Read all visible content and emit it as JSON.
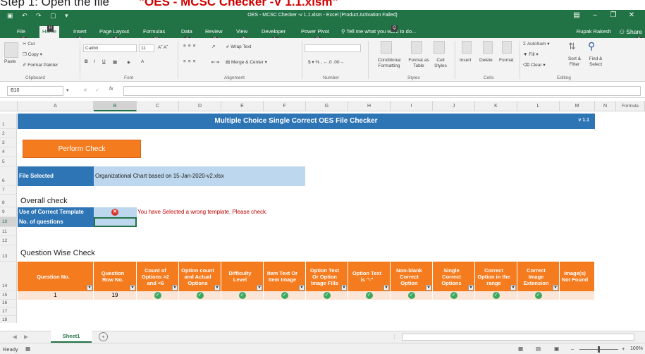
{
  "caption": {
    "prefix": "Step 1: Open the file",
    "file": "\"OES - MCSC Checker -V 1.1.xlsm\""
  },
  "window": {
    "title": "OES - MCSC Checker -v 1.1.xlsm - Excel (Product Activation Failed)"
  },
  "menu": {
    "tabs": [
      "File",
      "Home",
      "Insert",
      "Page Layout",
      "Formulas",
      "Data",
      "Review",
      "View",
      "Developer",
      "Power Pivot"
    ],
    "tell_me": "Tell me what you want to do...",
    "user": "Rupak Rakesh",
    "share": "Share",
    "keytips": [
      "F",
      "H",
      "N",
      "P",
      "M",
      "A",
      "R",
      "W",
      "L",
      "B",
      "Q",
      "Y"
    ]
  },
  "ribbon": {
    "clipboard": {
      "paste": "Paste",
      "cut": "Cut",
      "copy": "Copy",
      "format_painter": "Format Painter",
      "label": "Clipboard"
    },
    "font": {
      "name": "Calibri",
      "size": "11",
      "label": "Font"
    },
    "alignment": {
      "wrap": "Wrap Text",
      "merge": "Merge & Center",
      "label": "Alignment"
    },
    "number": {
      "format": "",
      "label": "Number"
    },
    "styles": {
      "conditional": "Conditional Formatting",
      "format_as_table": "Format as Table",
      "cell_styles": "Cell Styles",
      "label": "Styles"
    },
    "cells": {
      "insert": "Insert",
      "delete": "Delete",
      "format": "Format",
      "label": "Cells"
    },
    "editing": {
      "autosum": "AutoSum",
      "fill": "Fill",
      "clear": "Clear",
      "sort": "Sort & Filter",
      "find": "Find & Select",
      "label": "Editing"
    }
  },
  "formula_bar": {
    "name_box": "B10",
    "fx": "fx",
    "content": ""
  },
  "columns": [
    "A",
    "B",
    "C",
    "D",
    "E",
    "F",
    "G",
    "H",
    "I",
    "J",
    "K",
    "L",
    "M",
    "N"
  ],
  "rows": [
    "1",
    "2",
    "3",
    "4",
    "5",
    "6",
    "7",
    "8",
    "9",
    "10",
    "11",
    "12",
    "13",
    "14",
    "15",
    "16",
    "17",
    "18"
  ],
  "sheet": {
    "banner_title": "Multiple Choice Single Correct OES File Checker",
    "version": "v 1.1",
    "perform_button": "Perform Check",
    "file_selected_label": "File Selected",
    "file_selected_value": "Organizational Chart based on 15-Jan-2020-v2.xlsx",
    "overall_check": "Overall check",
    "template_label": "Use of Correct Template",
    "template_message": "You have Selected a wrong template. Please check.",
    "questions_label": "No. of questions",
    "question_wise": "Question Wise Check",
    "formula_label": "Formula",
    "table_headers": [
      "Question No.",
      "Question Row No.",
      "Count of Options >2 and <6",
      "Option count and Actual Options",
      "Difficulty Level",
      "Item Text Or Item Image",
      "Option Text Or Option Image Fills",
      "Option Text is \"-\"",
      "Non-blank Correct Option",
      "Single Correct Options",
      "Correct Option in the range",
      "Correct Image Extension",
      "Image(s) Not Found"
    ],
    "table_row": {
      "question_no": "1",
      "row_no": "19",
      "checks": [
        "ok",
        "ok",
        "ok",
        "ok",
        "ok",
        "ok",
        "ok",
        "ok",
        "ok",
        "ok",
        ""
      ]
    }
  },
  "tabs": {
    "sheet_name": "Sheet1",
    "add": "+"
  },
  "status": {
    "ready": "Ready",
    "zoom": "100%"
  },
  "colors": {
    "excel_green": "#217346",
    "banner_blue": "#2e75b6",
    "orange": "#f57b1f",
    "light_blue": "#bdd7ee",
    "error_red": "#c00000"
  }
}
